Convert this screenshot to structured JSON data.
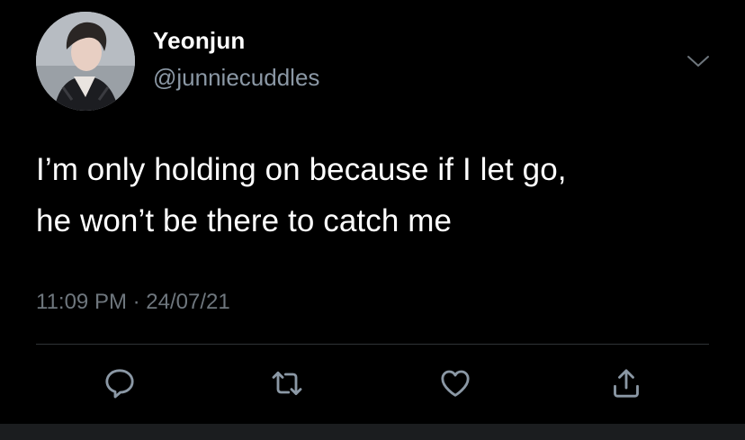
{
  "user": {
    "display_name": "Yeonjun",
    "handle": "@junniecuddles"
  },
  "tweet": {
    "lines": [
      "I’m only holding on because if I let go,",
      "he won’t be there to catch me"
    ],
    "time": "11:09 PM",
    "separator": "·",
    "date": "24/07/21"
  },
  "actions": [
    {
      "icon": "reply-icon"
    },
    {
      "icon": "retweet-icon"
    },
    {
      "icon": "like-icon"
    },
    {
      "icon": "share-icon"
    }
  ],
  "colors": {
    "background": "#000000",
    "text": "#ffffff",
    "secondary_text": "#8b98a5",
    "meta_text": "#6e767d",
    "icon": "#8b98a5",
    "divider": "#2f3336"
  }
}
